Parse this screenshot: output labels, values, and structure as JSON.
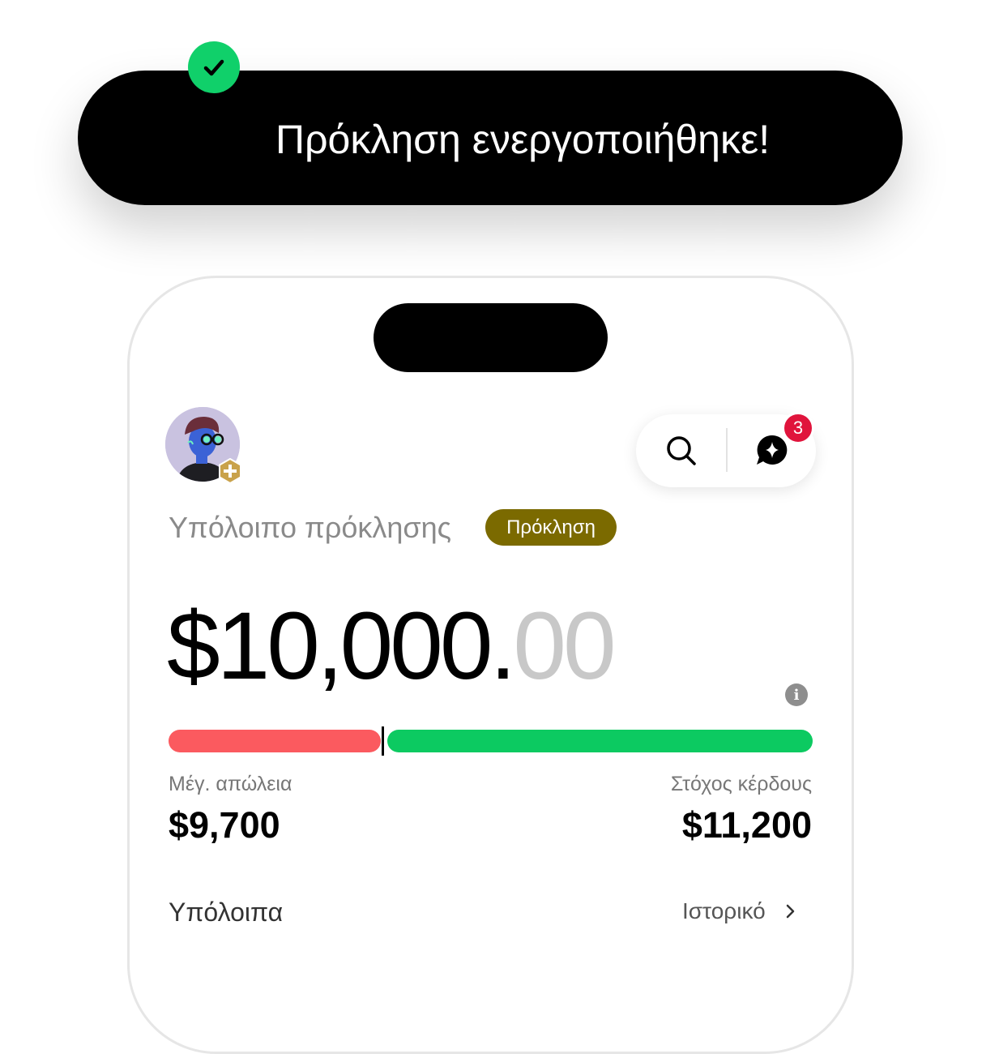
{
  "toast": {
    "message": "Πρόκληση ενεργοποιήθηκε!",
    "icon": "check-circle-icon",
    "icon_color": "#10d06a"
  },
  "header": {
    "notification_count": "3",
    "icons": [
      "search-icon",
      "chat-sparkle-icon"
    ]
  },
  "account": {
    "label": "Υπόλοιπο πρόκλησης",
    "tag": "Πρόκληση",
    "balance_main": "$10,000.",
    "balance_cents": "00"
  },
  "progress": {
    "max_loss_label": "Μέγ. απώλεια",
    "max_loss_value": "$9,700",
    "profit_target_label": "Στόχος κέρδους",
    "profit_target_value": "$11,200",
    "loss_color": "#fb5a5f",
    "gain_color": "#0cca61"
  },
  "balances": {
    "title": "Υπόλοιπα",
    "history_link": "Ιστορικό"
  }
}
